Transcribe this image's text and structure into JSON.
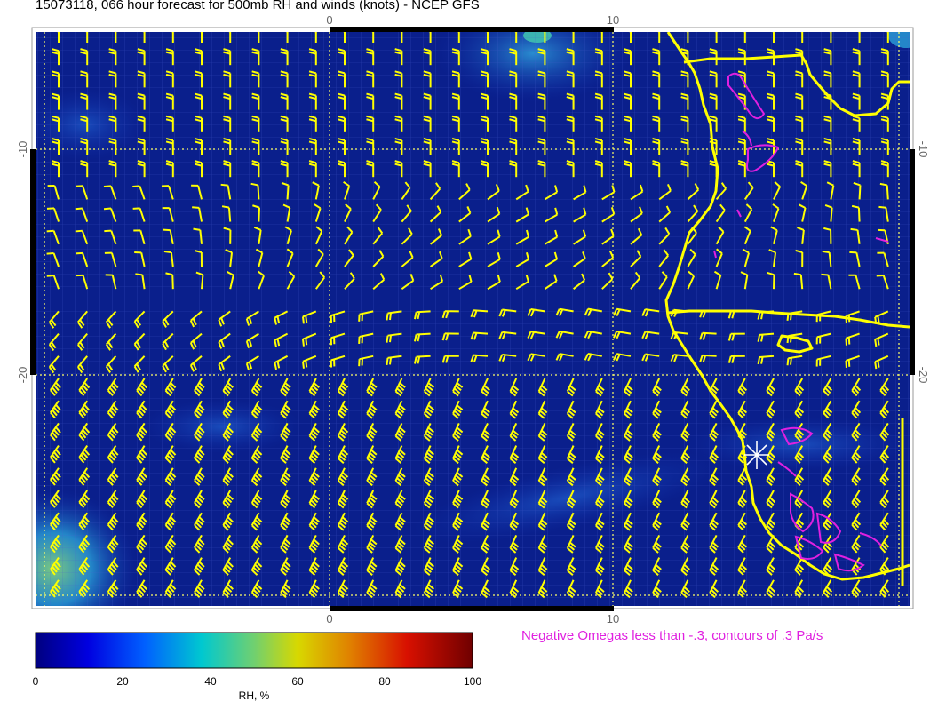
{
  "title": "15073118, 066 hour forecast for 500mb RH and winds (knots) - NCEP GFS",
  "axes": {
    "x_ticks_top": [
      "0",
      "10"
    ],
    "x_ticks_bottom": [
      "0",
      "10"
    ],
    "y_ticks_left": [
      "-10",
      "-20"
    ],
    "y_ticks_right": [
      "-10",
      "-20"
    ]
  },
  "omega_note": "Negative Omegas less than -.3, contours of .3 Pa/s",
  "colorbar": {
    "title": "RH, %",
    "labels": [
      "0",
      "20",
      "40",
      "60",
      "80",
      "100"
    ],
    "colors": [
      "#000080",
      "#0000ff",
      "#00c0c0",
      "#d4d400",
      "#e03000",
      "#800000"
    ]
  },
  "colors": {
    "background_fill": "#0a1f8c",
    "barbs": "#ffff00",
    "coastline": "#ffff00",
    "omega_contours": "#e020e0",
    "grid": "#ffff66"
  },
  "map_symbols": {
    "station_marker": "asterisk-icon"
  }
}
